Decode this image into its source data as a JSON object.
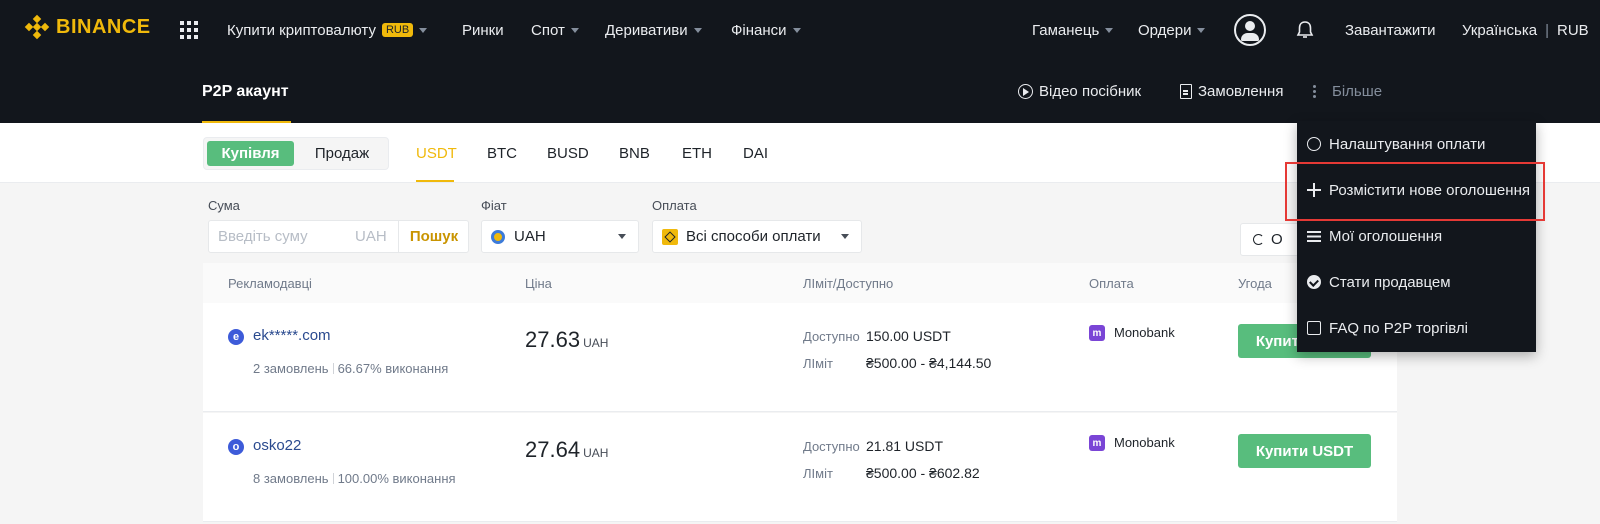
{
  "topnav": {
    "logo": "BINANCE",
    "buy_crypto": "Купити криптовалюту",
    "rub_badge": "RUB",
    "markets": "Ринки",
    "spot": "Спот",
    "derivatives": "Деривативи",
    "finance": "Фінанси",
    "wallet": "Гаманець",
    "orders": "Ордери",
    "download": "Завантажити",
    "language": "Українська",
    "currency": "RUB"
  },
  "subheader": {
    "title": "P2P акаунт",
    "video_guide": "Відео посібник",
    "orders": "Замовлення",
    "more": "Більше"
  },
  "tabs": {
    "buy": "Купівля",
    "sell": "Продаж",
    "coins": [
      "USDT",
      "BTC",
      "BUSD",
      "BNB",
      "ETH",
      "DAI"
    ],
    "active_coin": "USDT"
  },
  "filters": {
    "amount_label": "Сума",
    "amount_placeholder": "Введіть суму",
    "amount_unit": "UAH",
    "search": "Пошук",
    "fiat_label": "Фіат",
    "fiat_value": "UAH",
    "payment_label": "Оплата",
    "payment_value": "Всі способи оплати",
    "refresh_label": "О"
  },
  "table": {
    "headers": {
      "advertiser": "Рекламодавці",
      "price": "Ціна",
      "limit": "ЛІміт/Доступно",
      "payment": "Оплата",
      "trade": "Угода"
    },
    "rows": [
      {
        "avatar": "e",
        "name": "ek*****.com",
        "orders": "2 замовлень",
        "completion": "66.67% виконання",
        "price": "27.63",
        "price_unit": "UAH",
        "available_label": "Доступно",
        "available": "150.00 USDT",
        "limit_label": "ЛІміт",
        "limit": "₴500.00 - ₴4,144.50",
        "payment": "Monobank",
        "button": "Купити USDT"
      },
      {
        "avatar": "o",
        "name": "osko22",
        "orders": "8 замовлень",
        "completion": "100.00% виконання",
        "price": "27.64",
        "price_unit": "UAH",
        "available_label": "Доступно",
        "available": "21.81 USDT",
        "limit_label": "ЛІміт",
        "limit": "₴500.00 - ₴602.82",
        "payment": "Monobank",
        "button": "Купити USDT"
      }
    ]
  },
  "dropdown": {
    "items": [
      {
        "label": "Налаштування оплати",
        "icon": "coin-icon"
      },
      {
        "label": "Розмістити нове оголошення",
        "icon": "plus-icon"
      },
      {
        "label": "Мої оголошення",
        "icon": "sliders-icon"
      },
      {
        "label": "Стати продавцем",
        "icon": "check-icon"
      },
      {
        "label": "FAQ по P2P торгівлі",
        "icon": "faq-icon"
      }
    ]
  },
  "colors": {
    "accent": "#f0b90b",
    "buy_green": "#58bd7d",
    "dark_bg": "#12161c",
    "highlight": "#e53935"
  }
}
